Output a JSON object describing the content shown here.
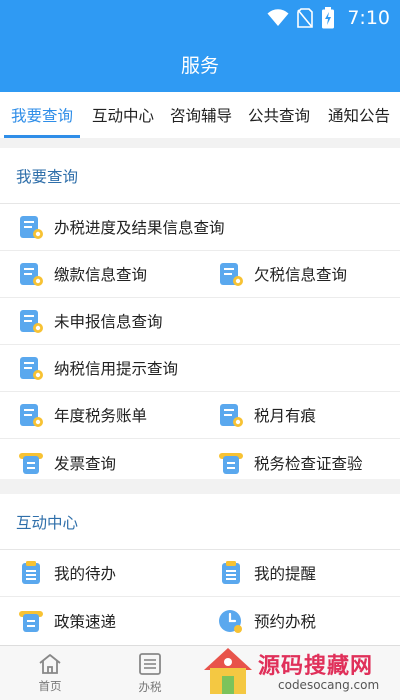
{
  "status_bar": {
    "time": "7:10"
  },
  "header": {
    "title": "服务"
  },
  "tabs": [
    {
      "label": "我要查询",
      "active": true
    },
    {
      "label": "互动中心"
    },
    {
      "label": "咨询辅导"
    },
    {
      "label": "公共查询"
    },
    {
      "label": "通知公告"
    }
  ],
  "query_section": {
    "title": "我要查询",
    "items": {
      "progress": "办税进度及结果信息查询",
      "payment": "缴款信息查询",
      "arrears": "欠税信息查询",
      "undeclared": "未申报信息查询",
      "credit": "纳税信用提示查询",
      "annual_bill": "年度税务账单",
      "tax_month": "税月有痕",
      "invoice": "发票查询",
      "inspection": "税务检查证查验"
    }
  },
  "interaction_section": {
    "title": "互动中心",
    "items": {
      "todo": "我的待办",
      "reminder": "我的提醒",
      "policy": "政策速递",
      "appointment": "预约办税"
    }
  },
  "bottom_nav": {
    "home": "首页",
    "tax": "办税"
  },
  "watermark": {
    "text": "源码搜藏网",
    "url": "codesocang.com"
  },
  "colors": {
    "primary": "#2f9af3",
    "tab_active": "#2f8ee8",
    "section_title": "#2f6faa"
  }
}
